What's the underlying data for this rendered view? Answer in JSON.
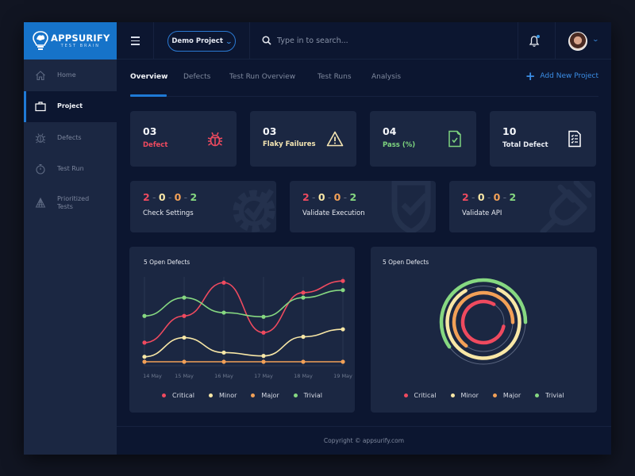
{
  "brand": {
    "name": "APPSURIFY",
    "tagline": "TEST BRAIN",
    "color": "#1673c9"
  },
  "header": {
    "project_selector": "Demo Project",
    "search_placeholder": "Type in to search...",
    "notification_icon": "bell-icon",
    "has_notification": true
  },
  "sidebar": {
    "items": [
      {
        "label": "Home",
        "icon": "home-icon",
        "active": false
      },
      {
        "label": "Project",
        "icon": "briefcase-icon",
        "active": true
      },
      {
        "label": "Defects",
        "icon": "bug-icon",
        "active": false
      },
      {
        "label": "Test Run",
        "icon": "stopwatch-icon",
        "active": false
      },
      {
        "label": "Prioritized Tests",
        "icon": "pyramid-icon",
        "active": false
      }
    ]
  },
  "tabs": [
    {
      "label": "Overview",
      "active": true
    },
    {
      "label": "Defects",
      "active": false
    },
    {
      "label": "Test Run Overview",
      "active": false
    },
    {
      "label": "Test Runs",
      "active": false
    },
    {
      "label": "Analysis",
      "active": false
    }
  ],
  "add_project_label": "Add New Project",
  "stats": [
    {
      "value": "03",
      "label": "Defect",
      "color": "#ef4a5f",
      "icon": "bug-icon"
    },
    {
      "value": "03",
      "label": "Flaky Failures",
      "color": "#f5e6b3",
      "icon": "warning-icon"
    },
    {
      "value": "04",
      "label": "Pass (%)",
      "color": "#7ed47f",
      "icon": "document-check-icon"
    },
    {
      "value": "10",
      "label": "Total Defect",
      "color": "#e8ebf2",
      "icon": "checklist-icon"
    }
  ],
  "progress_cards": [
    {
      "label": "Check Settings",
      "counts": [
        "2",
        "0",
        "0",
        "2"
      ],
      "icon": "gear-check-icon"
    },
    {
      "label": "Validate Execution",
      "counts": [
        "2",
        "0",
        "0",
        "2"
      ],
      "icon": "shield-check-icon"
    },
    {
      "label": "Validate API",
      "counts": [
        "2",
        "0",
        "0",
        "2"
      ],
      "icon": "plug-icon"
    }
  ],
  "series_colors": {
    "Critical": "#ef4a5f",
    "Minor": "#f8e7a6",
    "Major": "#f2a057",
    "Trivial": "#86d881"
  },
  "chart_data": [
    {
      "type": "line",
      "title": "5 Open Defects",
      "x": [
        "14 May",
        "15 May",
        "16 May",
        "17 May",
        "18 May",
        "19 May"
      ],
      "ylim": [
        0,
        10
      ],
      "grid": "vertical",
      "legend": "bottom",
      "series": [
        {
          "name": "Critical",
          "values": [
            2.3,
            5.5,
            9.5,
            3.5,
            8.3,
            9.7
          ]
        },
        {
          "name": "Minor",
          "values": [
            0.6,
            2.9,
            1.1,
            0.7,
            3.0,
            3.9
          ]
        },
        {
          "name": "Major",
          "values": [
            0,
            0,
            0,
            0,
            0,
            0
          ]
        },
        {
          "name": "Trivial",
          "values": [
            5.5,
            7.7,
            5.9,
            5.4,
            7.7,
            8.6
          ]
        }
      ]
    },
    {
      "type": "radial-bar",
      "title": "5 Open Defects",
      "legend": "bottom",
      "series": [
        {
          "name": "Critical",
          "percent": 80
        },
        {
          "name": "Minor",
          "percent": 85
        },
        {
          "name": "Major",
          "percent": 65
        },
        {
          "name": "Trivial",
          "percent": 60
        }
      ]
    }
  ],
  "legend_labels": [
    "Critical",
    "Minor",
    "Major",
    "Trivial"
  ],
  "footer": "Copyright © appsurify.com"
}
